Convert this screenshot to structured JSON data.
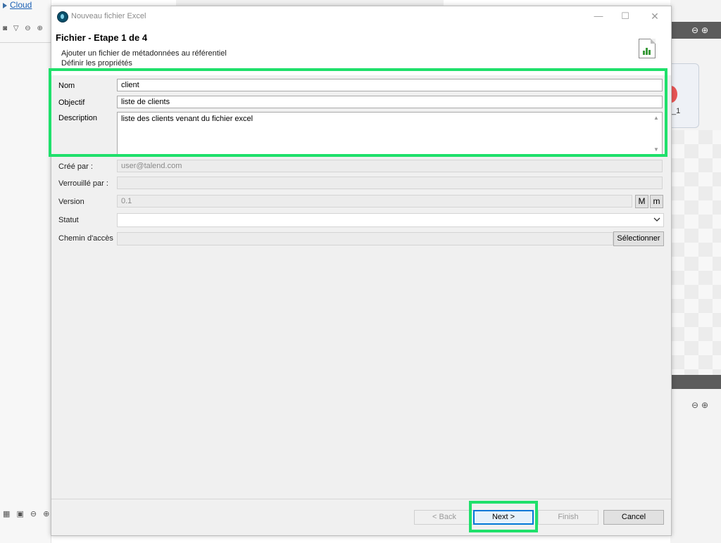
{
  "background": {
    "cloud_link": "Cloud",
    "right_number": "_1"
  },
  "dialog": {
    "title": "Nouveau fichier Excel",
    "step_title": "Fichier - Etape 1 de 4",
    "subtitle_line1": "Ajouter un fichier de métadonnées au référentiel",
    "subtitle_line2": "Définir les propriétés"
  },
  "form": {
    "name": {
      "label": "Nom",
      "value": "client"
    },
    "purpose": {
      "label": "Objectif",
      "value": "liste de clients"
    },
    "description": {
      "label": "Description",
      "value": "liste des clients venant du fichier excel"
    },
    "created_by": {
      "label": "Créé par :",
      "value": "user@talend.com"
    },
    "locked_by": {
      "label": "Verrouillé par :",
      "value": ""
    },
    "version": {
      "label": "Version",
      "value": "0.1",
      "major_button": "M",
      "minor_button": "m"
    },
    "status": {
      "label": "Statut",
      "value": ""
    },
    "path": {
      "label": "Chemin d'accès",
      "value": "",
      "button": "Sélectionner"
    }
  },
  "footer": {
    "back": "< Back",
    "next": "Next >",
    "finish": "Finish",
    "cancel": "Cancel"
  },
  "colors": {
    "highlight": "#1fe06b",
    "default_button_border": "#0078d7",
    "dialog_bg": "#f0f0f0"
  }
}
